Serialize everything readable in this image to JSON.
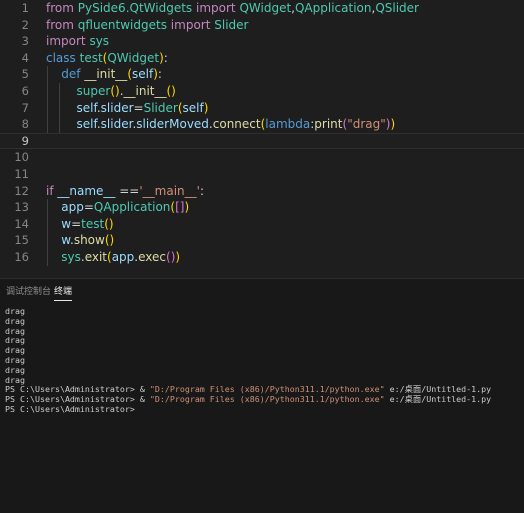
{
  "editor": {
    "line_numbers": [
      "1",
      "2",
      "3",
      "4",
      "5",
      "6",
      "7",
      "8",
      "9",
      "10",
      "11",
      "12",
      "13",
      "14",
      "15",
      "16"
    ],
    "current_line": "9",
    "lines": [
      [
        {
          "t": "from",
          "c": "kw"
        },
        {
          "t": " ",
          "c": "tx"
        },
        {
          "t": "PySide6.QtWidgets",
          "c": "cls"
        },
        {
          "t": " ",
          "c": "tx"
        },
        {
          "t": "import",
          "c": "kw"
        },
        {
          "t": " ",
          "c": "tx"
        },
        {
          "t": "QWidget",
          "c": "cls"
        },
        {
          "t": ",",
          "c": "tx"
        },
        {
          "t": "QApplication",
          "c": "cls"
        },
        {
          "t": ",",
          "c": "tx"
        },
        {
          "t": "QSlider",
          "c": "cls"
        }
      ],
      [
        {
          "t": "from",
          "c": "kw"
        },
        {
          "t": " ",
          "c": "tx"
        },
        {
          "t": "qfluentwidgets",
          "c": "cls"
        },
        {
          "t": " ",
          "c": "tx"
        },
        {
          "t": "import",
          "c": "kw"
        },
        {
          "t": " ",
          "c": "tx"
        },
        {
          "t": "Slider",
          "c": "cls"
        }
      ],
      [
        {
          "t": "import",
          "c": "kw"
        },
        {
          "t": " ",
          "c": "tx"
        },
        {
          "t": "sys",
          "c": "cls"
        }
      ],
      [
        {
          "t": "class",
          "c": "bl"
        },
        {
          "t": " ",
          "c": "tx"
        },
        {
          "t": "test",
          "c": "cls"
        },
        {
          "t": "(",
          "c": "p1"
        },
        {
          "t": "QWidget",
          "c": "cls"
        },
        {
          "t": ")",
          "c": "p1"
        },
        {
          "t": ":",
          "c": "tx"
        }
      ],
      [
        {
          "t": "    ",
          "c": "tx"
        },
        {
          "t": "def",
          "c": "bl"
        },
        {
          "t": " ",
          "c": "tx"
        },
        {
          "t": "__init__",
          "c": "fn"
        },
        {
          "t": "(",
          "c": "p1"
        },
        {
          "t": "self",
          "c": "vr"
        },
        {
          "t": ")",
          "c": "p1"
        },
        {
          "t": ":",
          "c": "tx"
        }
      ],
      [
        {
          "t": "        ",
          "c": "tx"
        },
        {
          "t": "super",
          "c": "cls"
        },
        {
          "t": "()",
          "c": "p1"
        },
        {
          "t": ".",
          "c": "tx"
        },
        {
          "t": "__init__",
          "c": "fn"
        },
        {
          "t": "()",
          "c": "p1"
        }
      ],
      [
        {
          "t": "        ",
          "c": "tx"
        },
        {
          "t": "self",
          "c": "vr"
        },
        {
          "t": ".",
          "c": "tx"
        },
        {
          "t": "slider",
          "c": "vr"
        },
        {
          "t": "=",
          "c": "tx"
        },
        {
          "t": "Slider",
          "c": "cls"
        },
        {
          "t": "(",
          "c": "p1"
        },
        {
          "t": "self",
          "c": "vr"
        },
        {
          "t": ")",
          "c": "p1"
        }
      ],
      [
        {
          "t": "        ",
          "c": "tx"
        },
        {
          "t": "self",
          "c": "vr"
        },
        {
          "t": ".",
          "c": "tx"
        },
        {
          "t": "slider",
          "c": "vr"
        },
        {
          "t": ".",
          "c": "tx"
        },
        {
          "t": "sliderMoved",
          "c": "vr"
        },
        {
          "t": ".",
          "c": "tx"
        },
        {
          "t": "connect",
          "c": "fn"
        },
        {
          "t": "(",
          "c": "p1"
        },
        {
          "t": "lambda",
          "c": "bl"
        },
        {
          "t": ":",
          "c": "tx"
        },
        {
          "t": "print",
          "c": "fn"
        },
        {
          "t": "(",
          "c": "p2"
        },
        {
          "t": "\"drag\"",
          "c": "str"
        },
        {
          "t": ")",
          "c": "p2"
        },
        {
          "t": ")",
          "c": "p1"
        }
      ],
      [],
      [],
      [],
      [
        {
          "t": "if",
          "c": "kw"
        },
        {
          "t": " ",
          "c": "tx"
        },
        {
          "t": "__name__",
          "c": "vr"
        },
        {
          "t": " ",
          "c": "tx"
        },
        {
          "t": "==",
          "c": "tx"
        },
        {
          "t": "'__main__'",
          "c": "str"
        },
        {
          "t": ":",
          "c": "tx"
        }
      ],
      [
        {
          "t": "    ",
          "c": "tx"
        },
        {
          "t": "app",
          "c": "vr"
        },
        {
          "t": "=",
          "c": "tx"
        },
        {
          "t": "QApplication",
          "c": "cls"
        },
        {
          "t": "(",
          "c": "p1"
        },
        {
          "t": "[",
          "c": "p2"
        },
        {
          "t": "]",
          "c": "p2"
        },
        {
          "t": ")",
          "c": "p1"
        }
      ],
      [
        {
          "t": "    ",
          "c": "tx"
        },
        {
          "t": "w",
          "c": "vr"
        },
        {
          "t": "=",
          "c": "tx"
        },
        {
          "t": "test",
          "c": "cls"
        },
        {
          "t": "()",
          "c": "p1"
        }
      ],
      [
        {
          "t": "    ",
          "c": "tx"
        },
        {
          "t": "w",
          "c": "vr"
        },
        {
          "t": ".",
          "c": "tx"
        },
        {
          "t": "show",
          "c": "fn"
        },
        {
          "t": "()",
          "c": "p1"
        }
      ],
      [
        {
          "t": "    ",
          "c": "tx"
        },
        {
          "t": "sys",
          "c": "cls"
        },
        {
          "t": ".",
          "c": "tx"
        },
        {
          "t": "exit",
          "c": "fn"
        },
        {
          "t": "(",
          "c": "p1"
        },
        {
          "t": "app",
          "c": "vr"
        },
        {
          "t": ".",
          "c": "tx"
        },
        {
          "t": "exec",
          "c": "fn"
        },
        {
          "t": "(",
          "c": "p2"
        },
        {
          "t": ")",
          "c": "p2"
        },
        {
          "t": ")",
          "c": "p1"
        }
      ]
    ]
  },
  "panel": {
    "tabs": [
      {
        "label": "调试控制台",
        "active": false
      },
      {
        "label": "终端",
        "active": true
      }
    ]
  },
  "terminal": {
    "lines": [
      [
        {
          "t": "drag",
          "c": "tx"
        }
      ],
      [
        {
          "t": "drag",
          "c": "tx"
        }
      ],
      [
        {
          "t": "drag",
          "c": "tx"
        }
      ],
      [
        {
          "t": "drag",
          "c": "tx"
        }
      ],
      [
        {
          "t": "drag",
          "c": "tx"
        }
      ],
      [
        {
          "t": "drag",
          "c": "tx"
        }
      ],
      [
        {
          "t": "drag",
          "c": "tx"
        }
      ],
      [
        {
          "t": "drag",
          "c": "tx"
        }
      ],
      [
        {
          "t": "PS C:\\Users\\Administrator> & ",
          "c": "tx"
        },
        {
          "t": "\"D:/Program Files (x86)/Python311.1/python.exe\"",
          "c": "str"
        },
        {
          "t": " e:/桌面/Untitled-1.py",
          "c": "tx"
        }
      ],
      [
        {
          "t": "PS C:\\Users\\Administrator> & ",
          "c": "tx"
        },
        {
          "t": "\"D:/Program Files (x86)/Python311.1/python.exe\"",
          "c": "str"
        },
        {
          "t": " e:/桌面/Untitled-1.py",
          "c": "tx"
        }
      ],
      [
        {
          "t": "PS C:\\Users\\Administrator> ",
          "c": "tx"
        }
      ]
    ]
  }
}
